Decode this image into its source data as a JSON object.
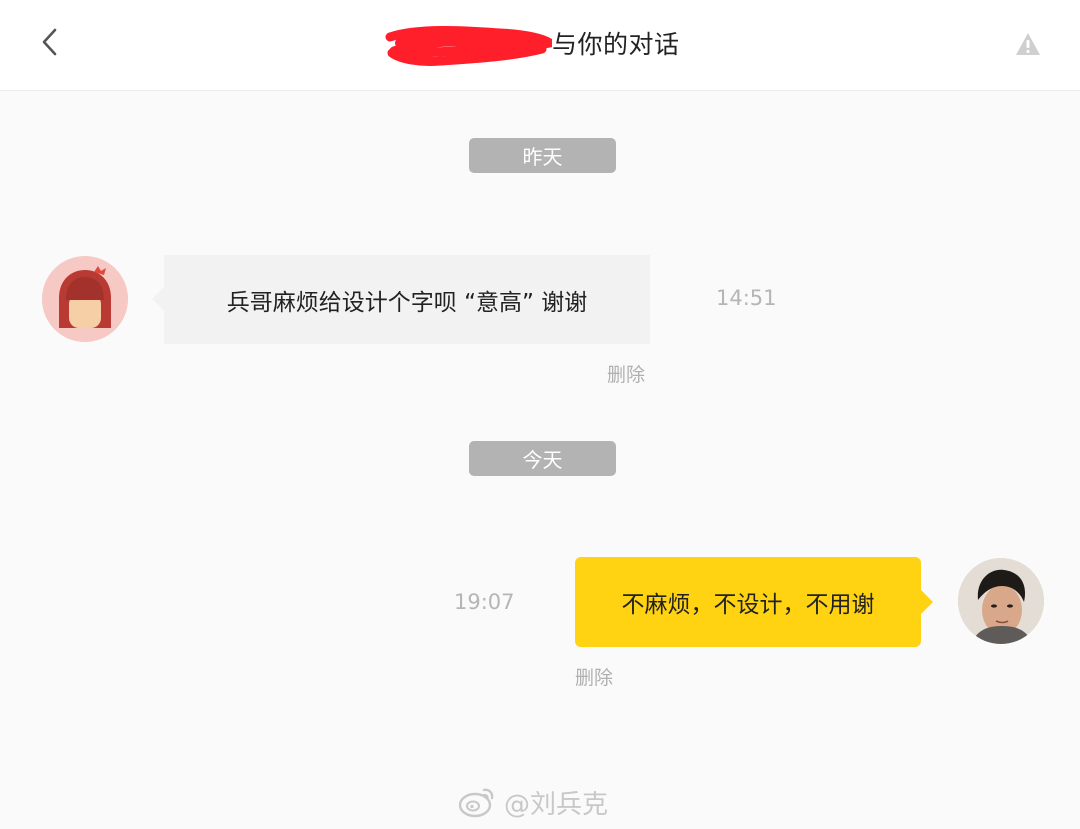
{
  "header": {
    "back_icon": "chevron-left-icon",
    "title_suffix": "与你的对话",
    "report_icon": "warning-triangle-icon"
  },
  "messages": [
    {
      "date_label": "昨天",
      "direction": "incoming",
      "text": "兵哥麻烦给设计个字呗 “意高” 谢谢",
      "time": "14:51",
      "delete_label": "删除"
    },
    {
      "date_label": "今天",
      "direction": "outgoing",
      "text": "不麻烦，不设计，不用谢",
      "time": "19:07",
      "delete_label": "删除"
    }
  ],
  "watermark": {
    "icon": "weibo-logo-icon",
    "text": "@刘兵克"
  },
  "colors": {
    "outgoing_bubble": "#ffd212",
    "incoming_bubble": "#f2f2f2",
    "date_pill": "#b3b3b3",
    "redaction": "#ff1f2a"
  }
}
